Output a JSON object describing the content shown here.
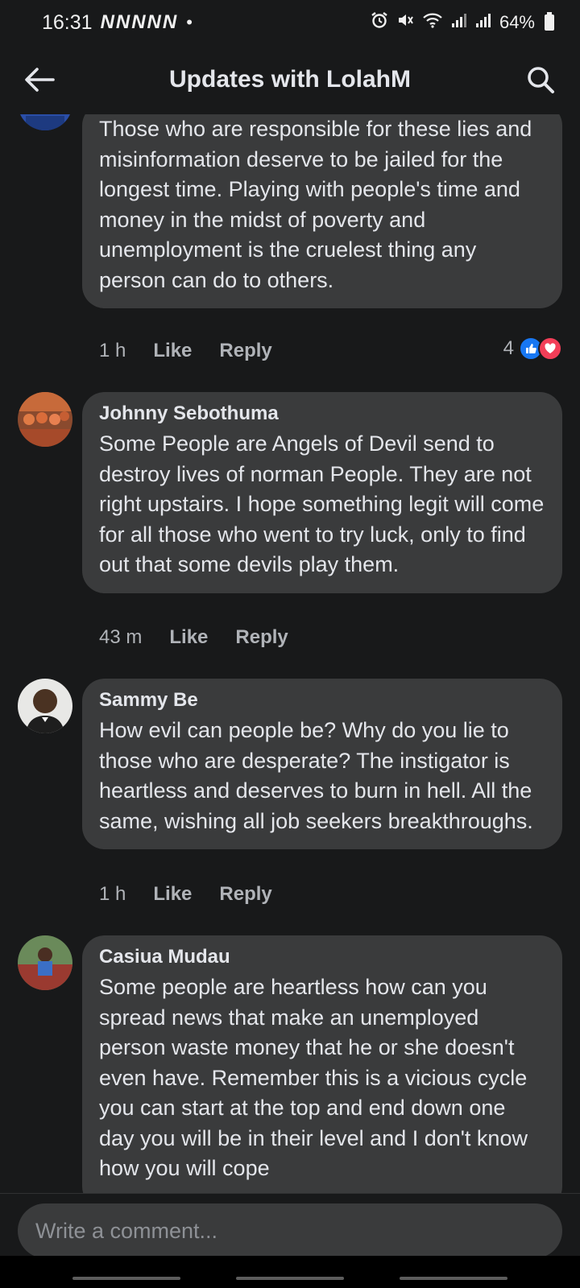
{
  "status_bar": {
    "time": "16:31",
    "notifications": "NNNNN",
    "dot": "•",
    "battery": "64%",
    "icons": [
      "alarm-icon",
      "mute-icon",
      "wifi-icon",
      "signal-icon",
      "signal-icon",
      "battery-icon"
    ]
  },
  "app_bar": {
    "title": "Updates with LolahM",
    "icons": [
      "back-arrow-icon",
      "search-icon"
    ]
  },
  "comments": [
    {
      "author": "",
      "text": "Those who are responsible for these lies and misinformation deserve to be jailed for the longest time. Playing with people's time and money in the midst of poverty and unemployment is the cruelest thing any person can do to others.",
      "time": "1 h",
      "like": "Like",
      "reply": "Reply",
      "reaction_count": "4",
      "reactions": [
        "like-icon",
        "love-icon"
      ]
    },
    {
      "author": "Johnny Sebothuma",
      "text": "Some People are Angels of Devil send to destroy lives of norman People. They are not right upstairs. I hope something legit will come for all those who went to try luck, only to find out that some devils play them.",
      "time": "43 m",
      "like": "Like",
      "reply": "Reply"
    },
    {
      "author": "Sammy Be",
      "text": "How evil can people be? Why do you lie to those who are desperate? The instigator is heartless and deserves to burn in hell. All the same, wishing all job seekers breakthroughs.",
      "time": "1 h",
      "like": "Like",
      "reply": "Reply"
    },
    {
      "author": "Casiua Mudau",
      "text": "Some people are heartless how can you spread news that make an unemployed person waste money that he or she doesn't even have. Remember this is a vicious cycle you can start at the top and end down one day you will be in their level and I don't know how you will cope"
    }
  ],
  "composer": {
    "placeholder": "Write a comment..."
  },
  "colors": {
    "background": "#18191a",
    "bubble": "#3a3b3c",
    "text": "#e4e6eb",
    "secondary_text": "#b0b3b8",
    "like_blue": "#1877f2",
    "love_red": "#f33e58"
  }
}
